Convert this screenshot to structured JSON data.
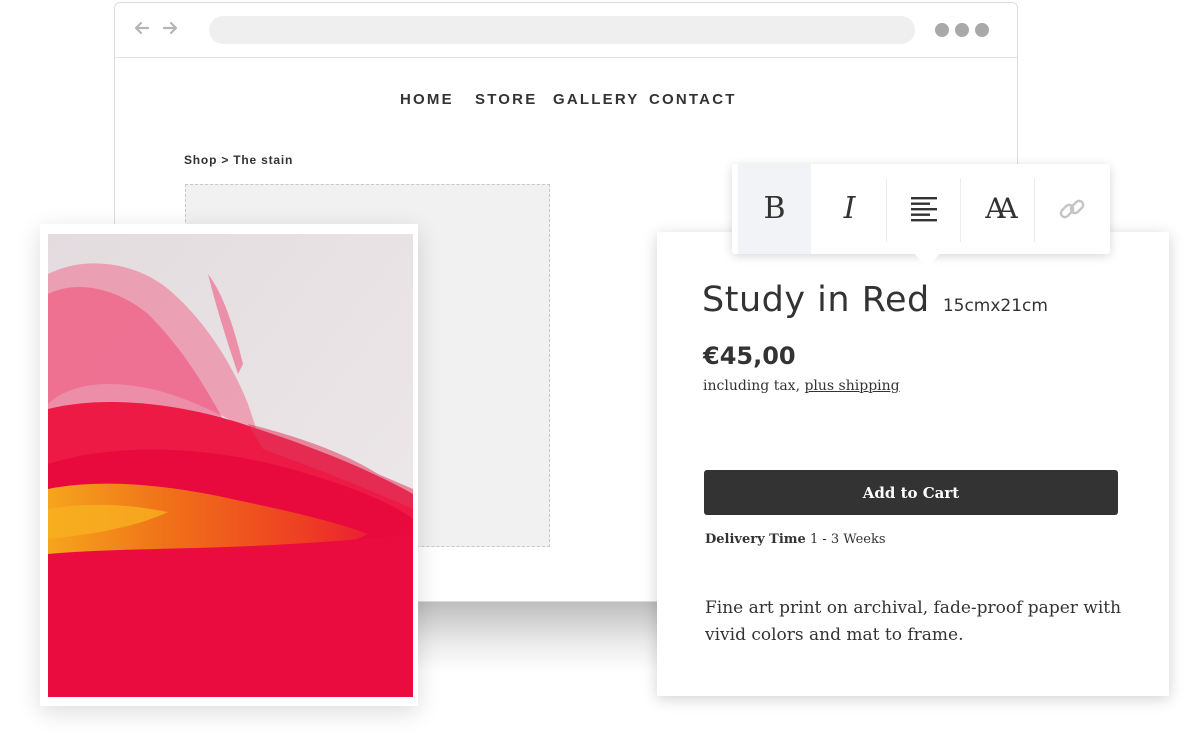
{
  "browser": {
    "back_icon": "arrow-left-icon",
    "forward_icon": "arrow-right-icon",
    "menu_icon": "more-dots-icon"
  },
  "site_nav": {
    "items": [
      {
        "label": "HOME"
      },
      {
        "label": "STORE"
      },
      {
        "label": "GALLERY"
      },
      {
        "label": "CONTACT"
      }
    ]
  },
  "breadcrumb": {
    "text": "Shop > The stain"
  },
  "toolbar": {
    "buttons": [
      {
        "icon": "bold-icon",
        "glyph": "B",
        "active": true
      },
      {
        "icon": "italic-icon",
        "glyph": "I",
        "active": false
      },
      {
        "icon": "align-left-icon",
        "active": false
      },
      {
        "icon": "font-size-icon",
        "glyph": "AA",
        "active": false
      },
      {
        "icon": "link-icon",
        "active": false
      }
    ]
  },
  "product": {
    "title": "Study in Red",
    "size": "15cmx21cm",
    "price": "€45,00",
    "tax_prefix": "including tax, ",
    "tax_link": "plus shipping",
    "add_to_cart": "Add to Cart",
    "delivery_label": "Delivery Time",
    "delivery_value": " 1 - 3 Weeks",
    "description": "Fine art print on archival, fade-proof paper with vivid colors and mat to frame."
  },
  "colors": {
    "button_bg": "#333333",
    "text": "#333333",
    "paint_red": "#e8003a",
    "paint_orange": "#f27a1a",
    "canvas": "#ece6e8"
  }
}
